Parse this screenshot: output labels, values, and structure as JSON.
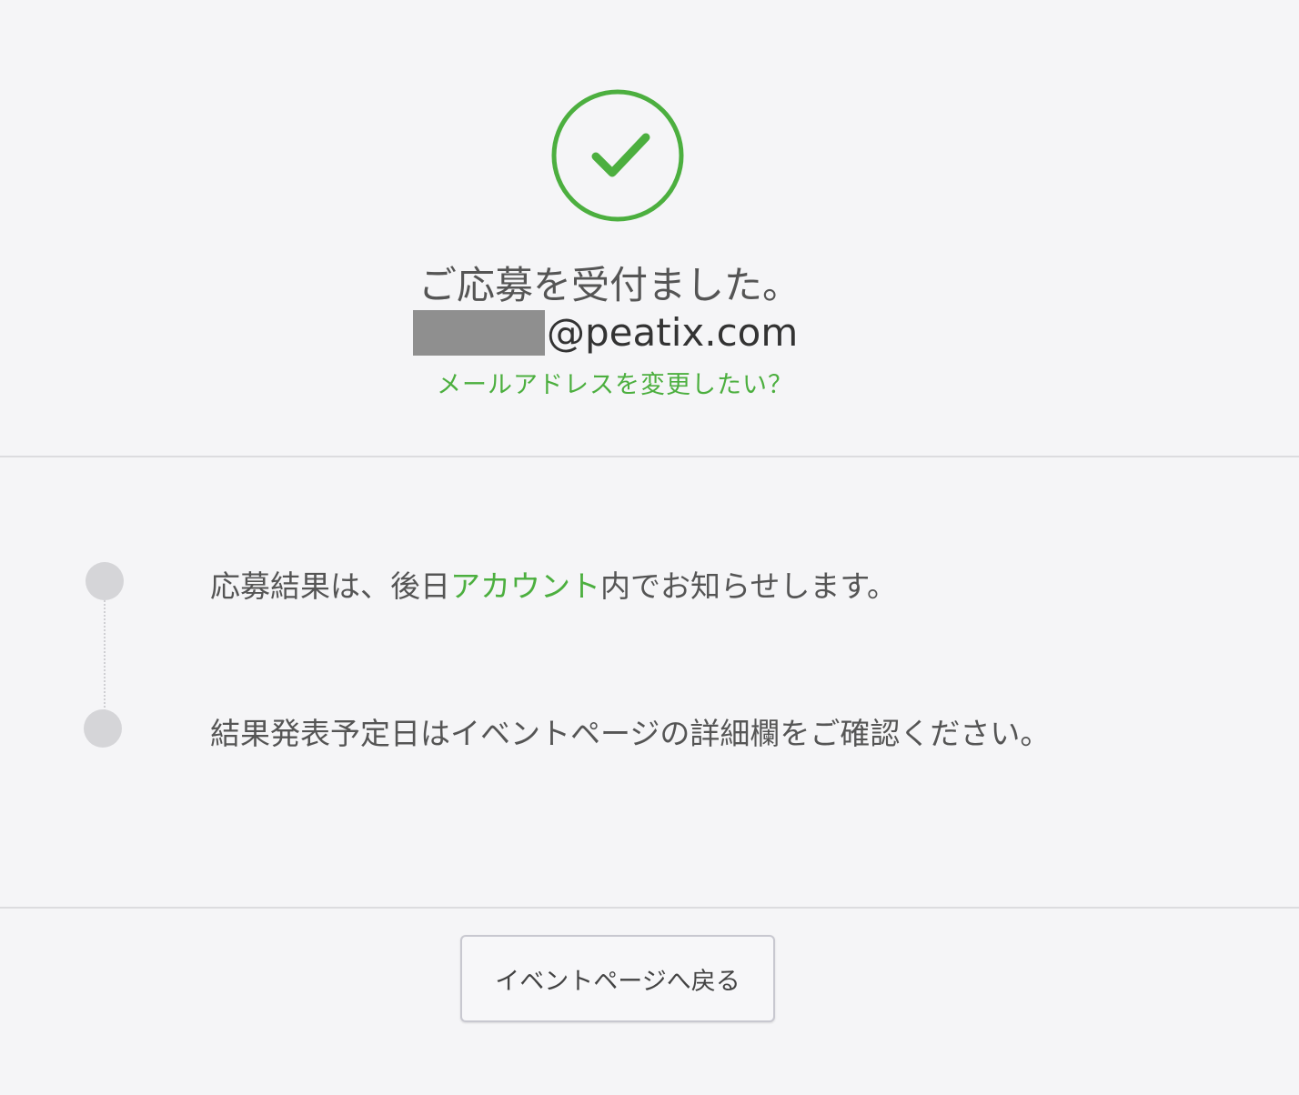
{
  "header": {
    "icon": "check-circle-icon",
    "title": "ご応募を受付ました。",
    "email_domain": "@peatix.com",
    "change_email_link": "メールアドレスを変更したい？"
  },
  "steps": [
    {
      "text_before": "応募結果は、後日",
      "link_text": "アカウント",
      "text_after": "内でお知らせします。"
    },
    {
      "text": "結果発表予定日はイベントページの詳細欄をご確認ください。"
    }
  ],
  "footer": {
    "back_button_label": "イベントページへ戻る"
  },
  "colors": {
    "accent": "#4caf3f",
    "background": "#f5f5f7",
    "text": "#555555",
    "divider": "#dcdcdf",
    "dot": "#d5d5d8"
  }
}
